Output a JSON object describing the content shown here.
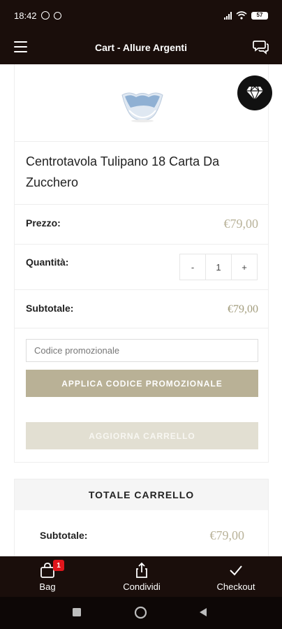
{
  "status": {
    "time": "18:42",
    "battery": "57"
  },
  "header": {
    "title": "Cart - Allure Argenti"
  },
  "product": {
    "name": "Centrotavola Tulipano 18 Carta Da Zucchero"
  },
  "rows": {
    "price_label": "Prezzo:",
    "price_value": "€79,00",
    "quantity_label": "Quantità:",
    "quantity_value": "1",
    "qty_minus": "-",
    "qty_plus": "+",
    "subtotal_label": "Subtotale:",
    "subtotal_value": "€79,00"
  },
  "promo": {
    "placeholder": "Codice promozionale",
    "apply_label": "APPLICA CODICE PROMOZIONALE",
    "update_label": "AGGIORNA CARRELLO"
  },
  "totals": {
    "title": "TOTALE CARRELLO",
    "subtotal_label": "Subtotale:",
    "subtotal_value": "€79,00"
  },
  "bottom_nav": {
    "bag_label": "Bag",
    "bag_count": "1",
    "share_label": "Condividi",
    "checkout_label": "Checkout"
  },
  "colors": {
    "bar": "#1a0e0b",
    "price": "#b9b39a",
    "primary_button": "#b9b196",
    "disabled_button": "#e2dfd2",
    "badge": "#e0161c"
  },
  "icons": [
    "alarm-icon",
    "sync-icon",
    "signal-icon",
    "wifi-icon",
    "battery-icon",
    "menu-icon",
    "chat-icon",
    "diamond-icon",
    "bag-icon",
    "share-icon",
    "checkmark-icon",
    "square-nav-icon",
    "circle-nav-icon",
    "back-nav-icon"
  ]
}
